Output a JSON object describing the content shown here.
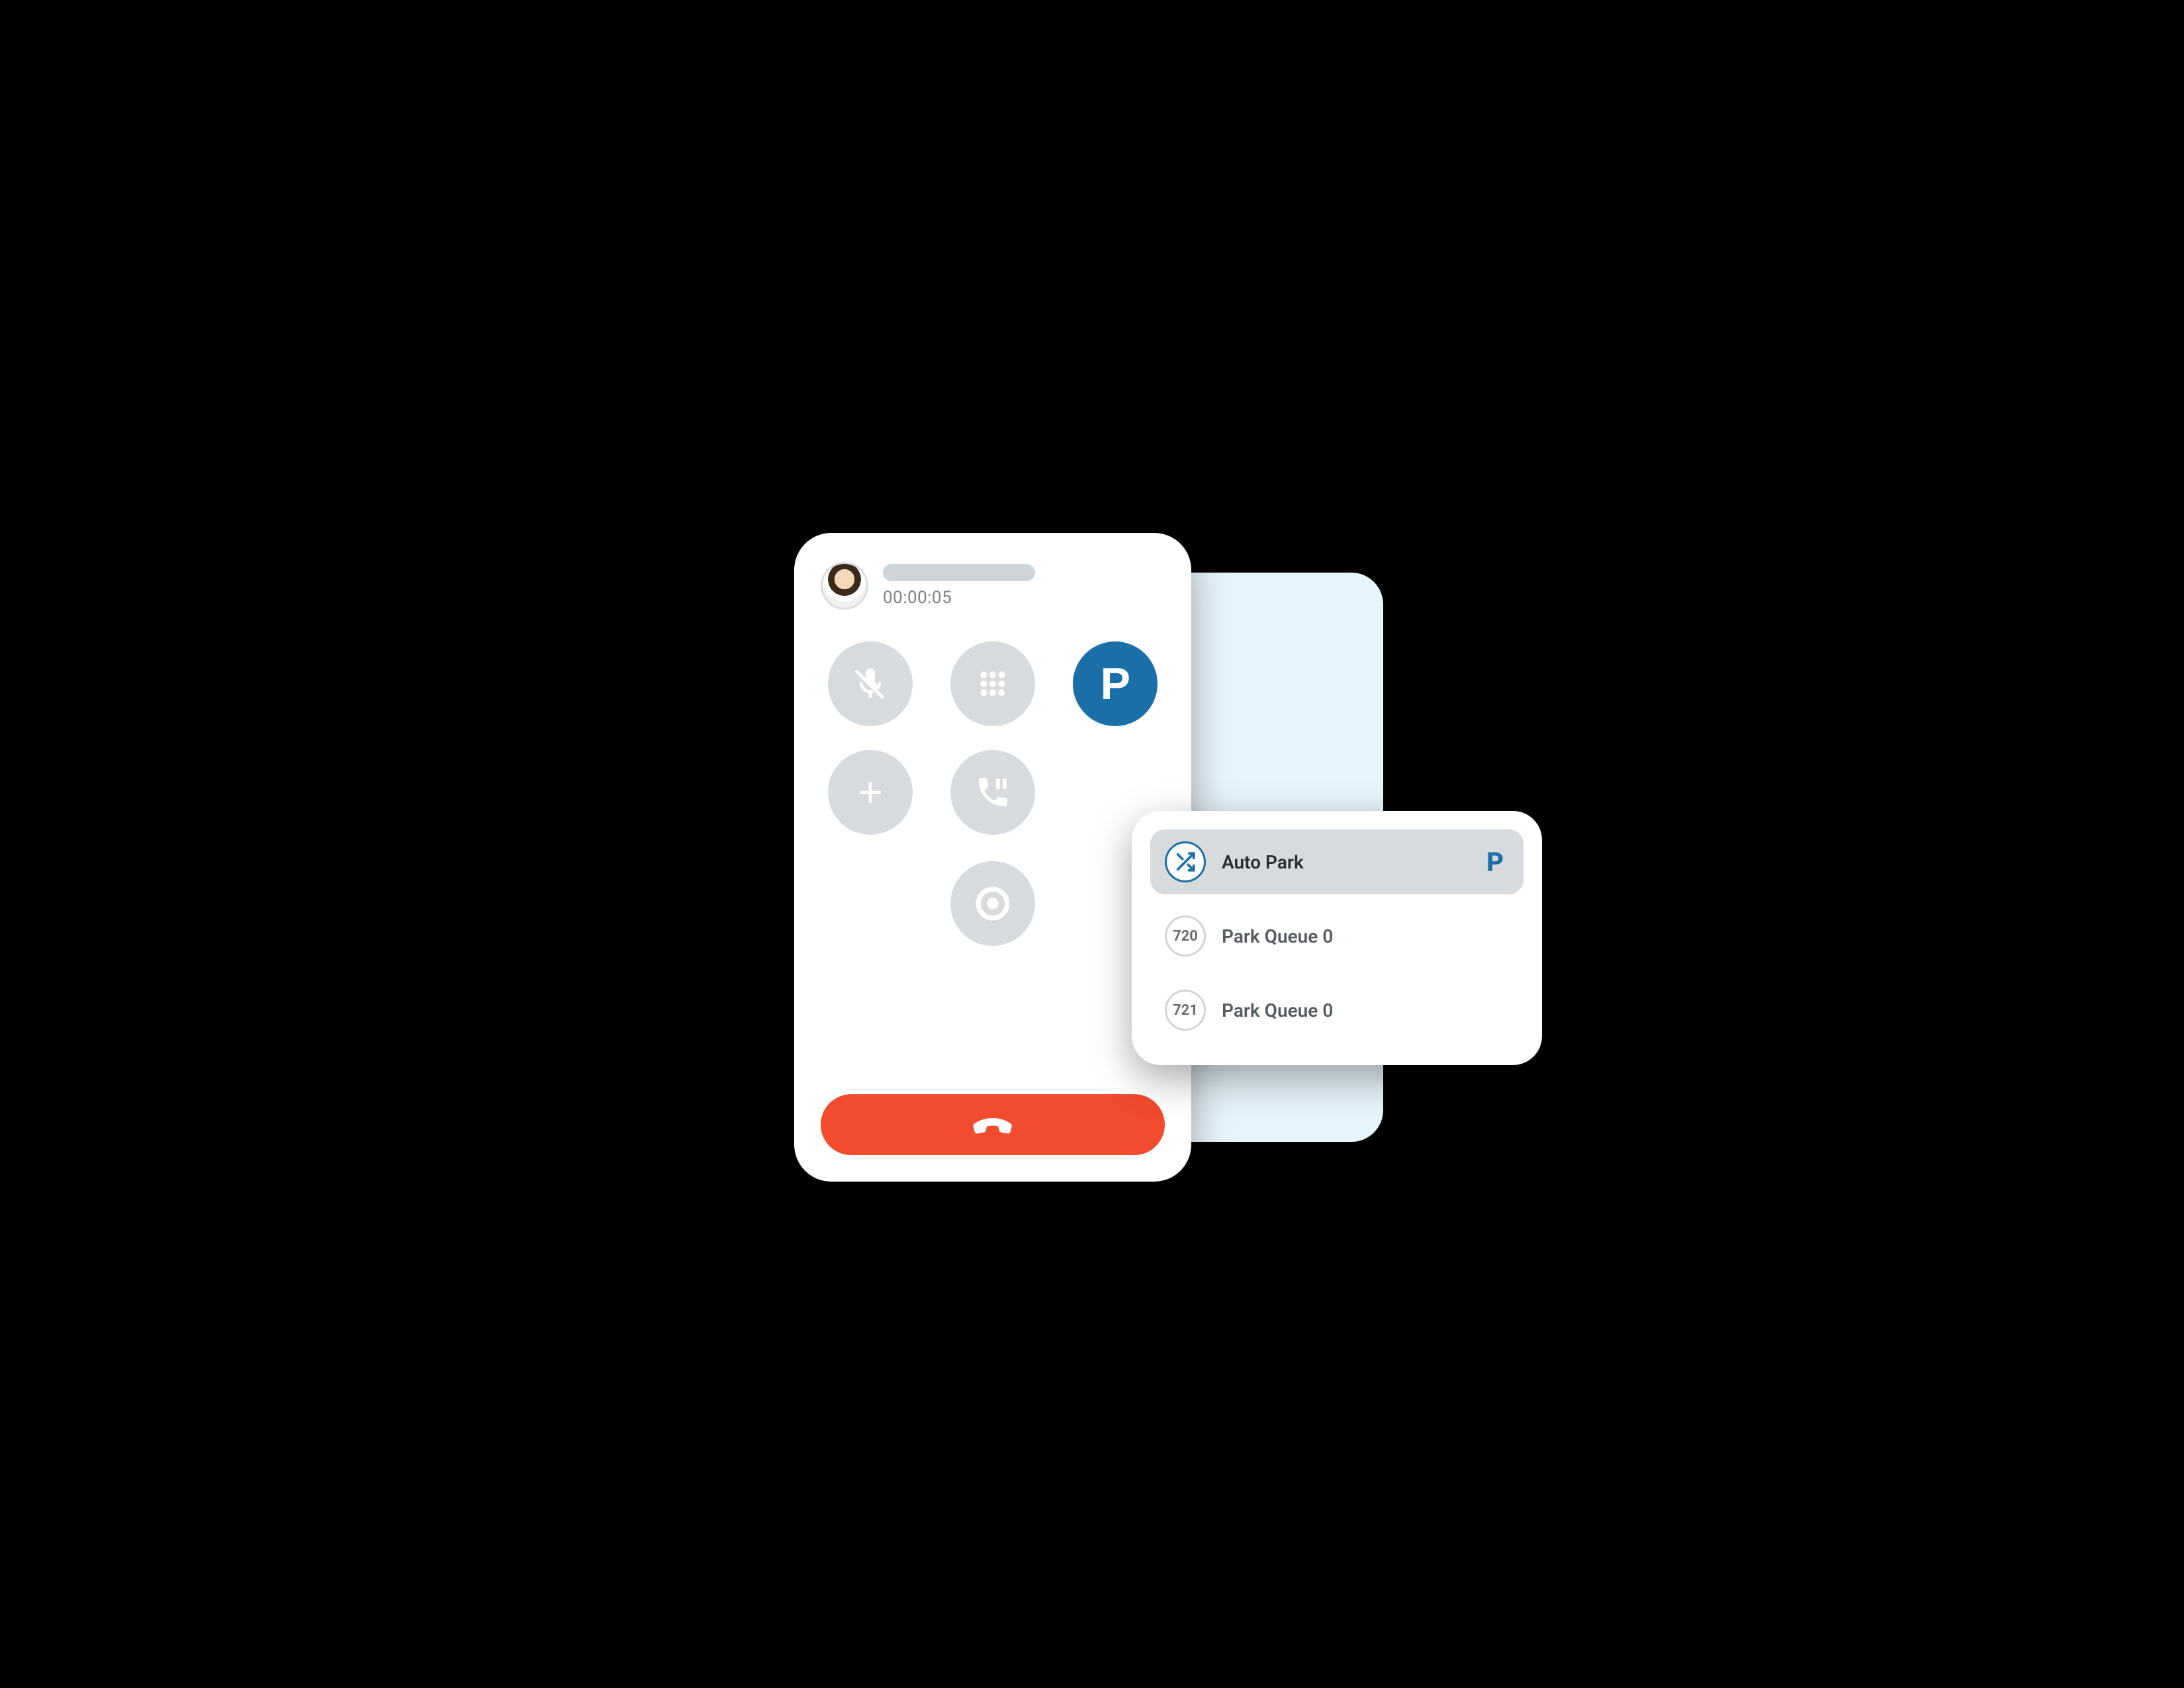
{
  "colors": {
    "accent_blue": "#1a6fa8",
    "light_blue_bg": "#e6f4fb",
    "button_grey": "#d7dbde",
    "hangup_red": "#f24b2e",
    "text_grey": "#7d8388"
  },
  "call": {
    "timer": "00:00:05",
    "buttons": {
      "mute_icon": "mic-muted-icon",
      "dialpad_icon": "dialpad-icon",
      "park_label": "P",
      "add_icon": "plus-icon",
      "hold_icon": "phone-pause-icon",
      "record_icon": "record-icon",
      "hangup_icon": "phone-hangup-icon"
    }
  },
  "park_menu": {
    "auto": {
      "label": "Auto Park",
      "trailing": "P",
      "icon": "shuffle-icon"
    },
    "slots": [
      {
        "ext": "720",
        "label": "Park Queue 0"
      },
      {
        "ext": "721",
        "label": "Park Queue 0"
      }
    ]
  }
}
